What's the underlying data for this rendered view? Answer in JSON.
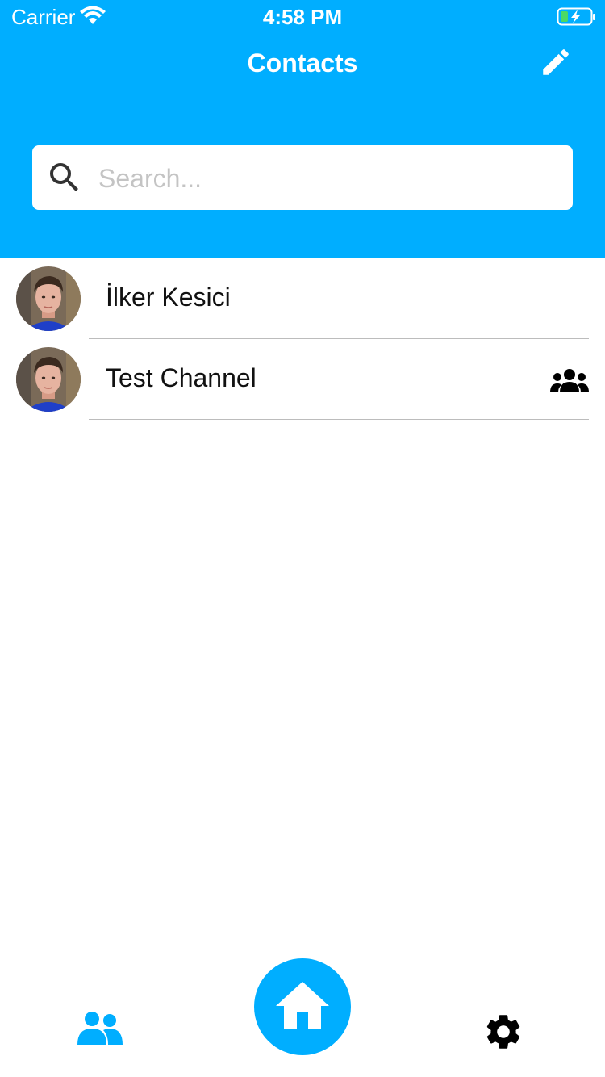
{
  "status_bar": {
    "carrier": "Carrier",
    "time": "4:58 PM"
  },
  "header": {
    "title": "Contacts",
    "edit_icon": "pencil-icon",
    "background_color": "#00aeff"
  },
  "search": {
    "placeholder": "Search...",
    "value": "",
    "icon": "search-icon"
  },
  "contacts": [
    {
      "name": "İlker Kesici",
      "is_group": false
    },
    {
      "name": "Test Channel",
      "is_group": true,
      "badge_icon": "group-icon"
    }
  ],
  "tab_bar": {
    "items": [
      {
        "icon": "contacts-icon",
        "active": true,
        "color": "#00aeff"
      },
      {
        "icon": "home-icon",
        "active": false,
        "color": "#00aeff"
      },
      {
        "icon": "gear-icon",
        "active": false,
        "color": "#000000"
      }
    ]
  }
}
